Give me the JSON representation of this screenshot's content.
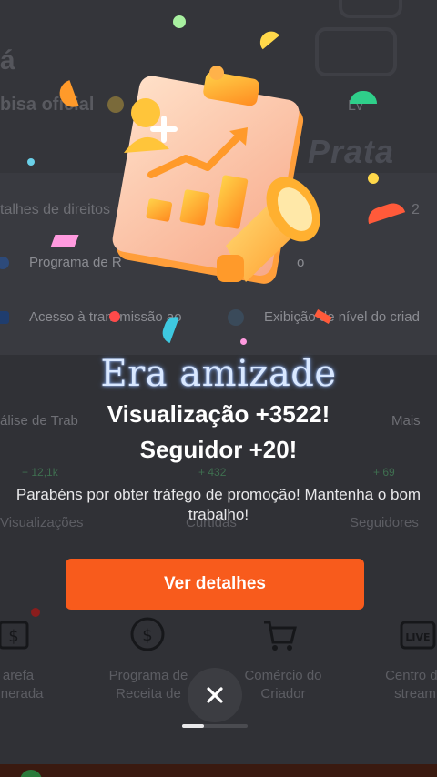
{
  "background": {
    "name_fragment": "á",
    "badge": "bisa oficial",
    "level_tag": "Lv",
    "tier": "Prata",
    "rights_label": "talhes de direitos",
    "rights_count": "2",
    "row1_left": "Programa de R",
    "row1_right": "o",
    "row2_left": "Acesso à transmissão ao",
    "row2_right": "Exibição de nível do criad",
    "analysis_label": "álise de Trab",
    "more_label": "Mais",
    "metrics": [
      {
        "delta": "+ 12,1k",
        "label": "Visualizações"
      },
      {
        "delta": "+ 432",
        "label": "Curtidas"
      },
      {
        "delta": "+ 69",
        "label": "Seguidores"
      }
    ],
    "shortcuts": [
      {
        "label": "Tarefa\nremunerada",
        "icon": "money-card-icon"
      },
      {
        "label": "Programa de\nReceita de",
        "icon": "dollar-circle-icon"
      },
      {
        "label": "Comércio do\nCriador",
        "icon": "shopping-cart-icon"
      },
      {
        "label": "Centro de\nstream",
        "icon": "live-icon"
      }
    ]
  },
  "modal": {
    "title": "Era amizade",
    "views_line": "Visualização +3522!",
    "followers_line": "Seguidor +20!",
    "message": "Parabéns por obter tráfego de promoção! Mantenha o bom trabalho!",
    "cta_label": "Ver detalhes",
    "close_icon": "close-icon"
  },
  "colors": {
    "accent": "#f85b1c",
    "overlay": "#2b2c30"
  }
}
